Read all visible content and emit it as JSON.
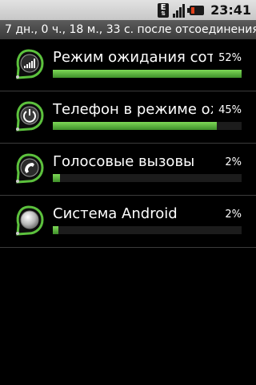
{
  "status_bar": {
    "network_type": "E",
    "time": "23:41",
    "signal_icon": "signal-bars-icon",
    "battery_icon": "battery-icon"
  },
  "title": "7 дн., 0 ч., 18 м., 33 с. после отсоединения",
  "items": [
    {
      "label": "Режим ожидания соты",
      "percent": "52%",
      "value": 0.52,
      "fill_fraction": 1.0,
      "icon": "cell-signal-icon"
    },
    {
      "label": "Телефон в режиме ожидания",
      "percent": "45%",
      "value": 0.45,
      "fill_fraction": 0.87,
      "icon": "power-icon"
    },
    {
      "label": "Голосовые вызовы",
      "percent": "2%",
      "value": 0.02,
      "fill_fraction": 0.04,
      "icon": "phone-handset-icon"
    },
    {
      "label": "Система Android",
      "percent": "2%",
      "value": 0.02,
      "fill_fraction": 0.03,
      "icon": "android-system-icon"
    }
  ],
  "colors": {
    "accent_green": "#5cc13d",
    "title_bar": "#4a4a4a",
    "divider": "#3b3b3b"
  }
}
